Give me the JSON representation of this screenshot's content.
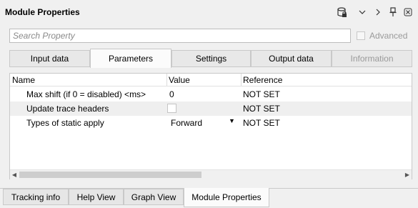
{
  "header": {
    "title": "Module Properties",
    "icons": [
      "database-lock-icon",
      "chevron-down-icon",
      "chevron-right-icon",
      "pin-icon",
      "close-icon"
    ]
  },
  "search": {
    "placeholder": "Search Property",
    "value": ""
  },
  "advanced": {
    "label": "Advanced",
    "checked": false
  },
  "tabs": [
    {
      "label": "Input data"
    },
    {
      "label": "Parameters"
    },
    {
      "label": "Settings"
    },
    {
      "label": "Output data"
    },
    {
      "label": "Information"
    }
  ],
  "active_tab": "Parameters",
  "table": {
    "columns": [
      "Name",
      "Value",
      "Reference"
    ],
    "rows": [
      {
        "name": "Max shift (if 0 = disabled) <ms>",
        "value": "0",
        "reference": "NOT SET"
      },
      {
        "name": "Update trace headers",
        "value": "",
        "reference": "NOT SET"
      },
      {
        "name": "Types of static apply",
        "value": "Forward",
        "reference": "NOT SET"
      }
    ]
  },
  "bottom_tabs": [
    {
      "label": "Tracking info"
    },
    {
      "label": "Help View"
    },
    {
      "label": "Graph View"
    },
    {
      "label": "Module Properties"
    }
  ],
  "active_bottom_tab": "Module Properties"
}
